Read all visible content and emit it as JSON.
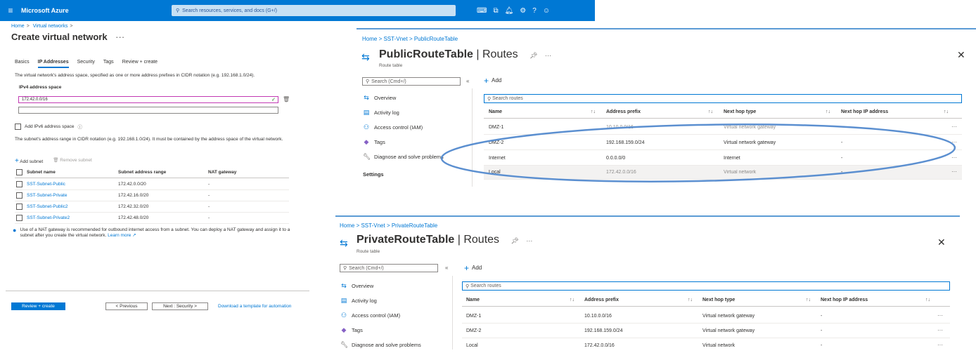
{
  "left": {
    "topbar": {
      "menu_icon": "hamburger-icon",
      "brand": "Microsoft Azure",
      "search_placeholder": "Search resources, services, and docs (G+/)",
      "icons": [
        "cloud-shell-icon",
        "directory-icon",
        "notifications-icon",
        "settings-icon",
        "help-icon",
        "feedback-icon"
      ]
    },
    "breadcrumb": [
      "Home",
      "Virtual networks"
    ],
    "title": "Create virtual network",
    "title_more": "···",
    "tabs": [
      "Basics",
      "IP Addresses",
      "Security",
      "Tags",
      "Review + create"
    ],
    "active_tab": "IP Addresses",
    "address_intro": "The virtual network's address space, specified as one or more address prefixes in CIDR notation (e.g. 192.168.1.0/24).",
    "ipv4_label": "IPv4 address space",
    "ipv4_value": "172.42.0.0/16",
    "add_ipv6_label": "Add IPv6 address space",
    "subnet_intro": "The subnet's address range in CIDR notation (e.g. 192.168.1.0/24). It must be contained by the address space of the virtual network.",
    "add_subnet": "Add subnet",
    "remove_subnet": "Remove subnet",
    "subnet_headers": [
      "Subnet name",
      "Subnet address range",
      "NAT gateway"
    ],
    "subnets": [
      {
        "name": "SST-Subnet-Public",
        "range": "172.42.0.0/20",
        "nat": "-"
      },
      {
        "name": "SST-Subnet-Private",
        "range": "172.42.16.0/20",
        "nat": "-"
      },
      {
        "name": "SST-Subnet-Public2",
        "range": "172.42.32.0/20",
        "nat": "-"
      },
      {
        "name": "SST-Subnet-Private2",
        "range": "172.42.48.0/20",
        "nat": "-"
      }
    ],
    "nat_info": "Use of a NAT gateway is recommended for outbound internet access from a subnet. You can deploy a NAT gateway and assign it to a subnet after you create the virtual network.",
    "learn_more": "Learn more",
    "footer": {
      "review_create": "Review + create",
      "previous": "< Previous",
      "next": "Next : Security >",
      "download": "Download a template for automation"
    }
  },
  "public_rt": {
    "breadcrumb": [
      "Home",
      "SST-Vnet",
      "PublicRouteTable"
    ],
    "title_bold": "PublicRouteTable",
    "title_rest": " | Routes",
    "subtitle": "Route table",
    "search_placeholder": "Search (Cmd+/)",
    "collapse": "«",
    "nav": [
      {
        "label": "Overview",
        "icon": "overview-icon"
      },
      {
        "label": "Activity log",
        "icon": "activity-log-icon"
      },
      {
        "label": "Access control (IAM)",
        "icon": "access-control-icon"
      },
      {
        "label": "Tags",
        "icon": "tag-icon"
      },
      {
        "label": "Diagnose and solve problems",
        "icon": "wrench-icon"
      }
    ],
    "settings_label": "Settings",
    "add_label": "Add",
    "search_routes": "Search routes",
    "headers": [
      "Name",
      "Address prefix",
      "Next hop type",
      "Next hop IP address"
    ],
    "rows": [
      {
        "name": "DMZ-1",
        "prefix": "10.10.0.0/16",
        "hop": "Virtual network gateway",
        "ip": ""
      },
      {
        "name": "DMZ-2",
        "prefix": "192.168.159.0/24",
        "hop": "Virtual network gateway",
        "ip": "-"
      },
      {
        "name": "Internet",
        "prefix": "0.0.0.0/0",
        "hop": "Internet",
        "ip": "-"
      },
      {
        "name": "Local",
        "prefix": "172.42.0.0/16",
        "hop": "Virtual network",
        "ip": "-"
      }
    ],
    "annotation_color": "#5b8fd0"
  },
  "private_rt": {
    "breadcrumb": [
      "Home",
      "SST-Vnet",
      "PrivateRouteTable"
    ],
    "title_bold": "PrivateRouteTable",
    "title_rest": " | Routes",
    "subtitle": "Route table",
    "search_placeholder": "Search (Cmd+/)",
    "collapse": "«",
    "nav": [
      {
        "label": "Overview",
        "icon": "overview-icon"
      },
      {
        "label": "Activity log",
        "icon": "activity-log-icon"
      },
      {
        "label": "Access control (IAM)",
        "icon": "access-control-icon"
      },
      {
        "label": "Tags",
        "icon": "tag-icon"
      },
      {
        "label": "Diagnose and solve problems",
        "icon": "wrench-icon"
      }
    ],
    "add_label": "Add",
    "search_routes": "Search routes",
    "headers": [
      "Name",
      "Address prefix",
      "Next hop type",
      "Next hop IP address"
    ],
    "rows": [
      {
        "name": "DMZ-1",
        "prefix": "10.10.0.0/16",
        "hop": "Virtual network gateway",
        "ip": "-"
      },
      {
        "name": "DMZ-2",
        "prefix": "192.168.159.0/24",
        "hop": "Virtual network gateway",
        "ip": "-"
      },
      {
        "name": "Local",
        "prefix": "172.42.0.0/16",
        "hop": "Virtual network",
        "ip": "-"
      }
    ]
  },
  "colors": {
    "azure_blue": "#0078d4",
    "panel_border": "#5b9bd5"
  }
}
